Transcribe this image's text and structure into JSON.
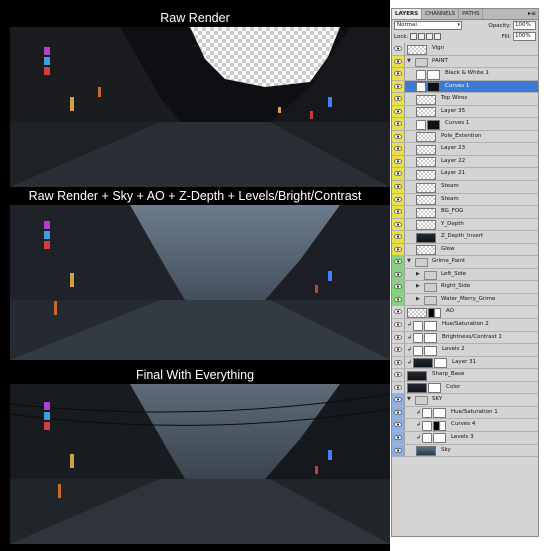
{
  "panels": [
    {
      "title": "Raw Render"
    },
    {
      "title": "Raw Render + Sky + AO + Z-Depth + Levels/Bright/Contrast"
    },
    {
      "title": "Final With Everything"
    }
  ],
  "layers_panel": {
    "tabs": [
      "LAYERS",
      "CHANNELS",
      "PATHS"
    ],
    "blend_mode": "Normal",
    "opacity_label": "Opacity:",
    "opacity_value": "100%",
    "lock_label": "Lock:",
    "fill_label": "Fill:",
    "fill_value": "100%",
    "layers": [
      {
        "name": "Vign",
        "eye": "none",
        "indent": 0,
        "thumb": "check"
      },
      {
        "name": "PAINT",
        "eye": "yellow",
        "indent": 0,
        "thumb": "folder",
        "group": true
      },
      {
        "name": "Black & White 1",
        "eye": "yellow",
        "indent": 1,
        "thumb": "adjmask"
      },
      {
        "name": "Curves 1",
        "eye": "yellow",
        "indent": 1,
        "thumb": "adjdark",
        "selected": true
      },
      {
        "name": "Top Wires",
        "eye": "yellow",
        "indent": 1,
        "thumb": "check"
      },
      {
        "name": "Layer 35",
        "eye": "yellow",
        "indent": 1,
        "thumb": "check"
      },
      {
        "name": "Curves 1",
        "eye": "yellow",
        "indent": 1,
        "thumb": "adjdark"
      },
      {
        "name": "Pole_Extention",
        "eye": "yellow",
        "indent": 1,
        "thumb": "check"
      },
      {
        "name": "Layer 23",
        "eye": "yellow",
        "indent": 1,
        "thumb": "check"
      },
      {
        "name": "Layer 22",
        "eye": "yellow",
        "indent": 1,
        "thumb": "check"
      },
      {
        "name": "Layer 21",
        "eye": "yellow",
        "indent": 1,
        "thumb": "check"
      },
      {
        "name": "Steam",
        "eye": "yellow",
        "indent": 1,
        "thumb": "check"
      },
      {
        "name": "Steam",
        "eye": "yellow",
        "indent": 1,
        "thumb": "check"
      },
      {
        "name": "BG_FOG",
        "eye": "yellow",
        "indent": 1,
        "thumb": "check"
      },
      {
        "name": "Y_Depth",
        "eye": "yellow",
        "indent": 1,
        "thumb": "check"
      },
      {
        "name": "Z_Depth_Invert",
        "eye": "yellow",
        "indent": 1,
        "thumb": "dark"
      },
      {
        "name": "Glow",
        "eye": "yellow",
        "indent": 1,
        "thumb": "check"
      },
      {
        "name": "Grime_Paint",
        "eye": "green",
        "indent": 0,
        "thumb": "folder",
        "group": true
      },
      {
        "name": "Left_Side",
        "eye": "green",
        "indent": 1,
        "thumb": "folder",
        "group": true,
        "collapsed": true
      },
      {
        "name": "Right_Side",
        "eye": "green",
        "indent": 1,
        "thumb": "folder",
        "group": true,
        "collapsed": true
      },
      {
        "name": "Water_Merry_Grime",
        "eye": "green",
        "indent": 1,
        "thumb": "folder",
        "group": true,
        "collapsed": true
      },
      {
        "name": "AO",
        "eye": "none",
        "indent": 0,
        "thumb": "ao"
      },
      {
        "name": "Hue/Saturation 2",
        "eye": "none",
        "indent": 0,
        "thumb": "adj",
        "clip": true
      },
      {
        "name": "Brightness/Contrast 1",
        "eye": "none",
        "indent": 0,
        "thumb": "adj",
        "clip": true
      },
      {
        "name": "Levels 2",
        "eye": "none",
        "indent": 0,
        "thumb": "adj",
        "clip": true
      },
      {
        "name": "Layer 31",
        "eye": "none",
        "indent": 0,
        "thumb": "darkpair",
        "clip": true
      },
      {
        "name": "Sharp_Base",
        "eye": "none",
        "indent": 0,
        "thumb": "dark"
      },
      {
        "name": "Color",
        "eye": "none",
        "indent": 0,
        "thumb": "darkpair"
      },
      {
        "name": "SKY",
        "eye": "blue",
        "indent": 0,
        "thumb": "folder",
        "group": true
      },
      {
        "name": "Hue/Saturation 1",
        "eye": "blue",
        "indent": 1,
        "thumb": "adj",
        "clip": true
      },
      {
        "name": "Curves 4",
        "eye": "blue",
        "indent": 1,
        "thumb": "adjgrad",
        "clip": true
      },
      {
        "name": "Levels 3",
        "eye": "blue",
        "indent": 1,
        "thumb": "adj",
        "clip": true
      },
      {
        "name": "Sky",
        "eye": "blue",
        "indent": 1,
        "thumb": "sky"
      }
    ]
  },
  "colors": {
    "selected": "#3d7ad6",
    "eye_yellow": "#e8df4a",
    "eye_green": "#7fd77a",
    "eye_blue": "#88b0ea"
  }
}
